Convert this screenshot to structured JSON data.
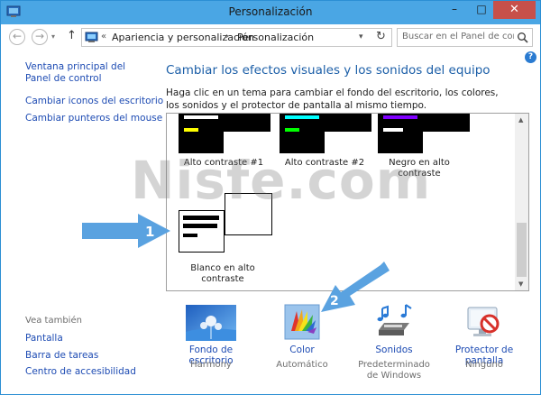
{
  "window": {
    "title": "Personalización",
    "minimize_glyph": "–",
    "maximize_glyph": "□",
    "close_glyph": "✕"
  },
  "nav": {
    "back_glyph": "←",
    "forward_glyph": "→",
    "history_glyph": "▾",
    "up_glyph": "↑",
    "breadcrumb_sep": "«",
    "breadcrumb_sep2": "›",
    "breadcrumb": [
      "Apariencia y personalización",
      "Personalización"
    ],
    "address_dropdown_glyph": "▾",
    "refresh_glyph": "↻",
    "search_placeholder": "Buscar en el Panel de con..."
  },
  "help_glyph": "?",
  "sidebar": {
    "links": [
      "Ventana principal del Panel de control",
      "Cambiar iconos del escritorio",
      "Cambiar punteros del mouse"
    ],
    "see_also_title": "Vea también",
    "see_also": [
      "Pantalla",
      "Barra de tareas",
      "Centro de accesibilidad"
    ]
  },
  "main": {
    "title": "Cambiar los efectos visuales y los sonidos del equipo",
    "description": "Haga clic en un tema para cambiar el fondo del escritorio, los colores, los sonidos y el protector de pantalla al mismo tiempo."
  },
  "themes": [
    {
      "label": "Alto contraste #1",
      "bar1": "#ffffff",
      "bar2": "#ffff00"
    },
    {
      "label": "Alto contraste #2",
      "bar1": "#00ffff",
      "bar2": "#00ff00"
    },
    {
      "label": "Negro en alto contraste",
      "bar1": "#8000ff",
      "bar2": "#ffffff"
    },
    {
      "label": "Blanco en alto contraste"
    }
  ],
  "watermark": "Nisfe.com",
  "annotations": [
    "1",
    "2"
  ],
  "bottom": [
    {
      "label": "Fondo de escritorio",
      "sub": "Harmony"
    },
    {
      "label": "Color",
      "sub": "Automático"
    },
    {
      "label": "Sonidos",
      "sub": "Predeterminado de Windows"
    },
    {
      "label": "Protector de pantalla",
      "sub": "Ninguno"
    }
  ],
  "colors": {
    "titlebar": "#4aa6e4",
    "close_button": "#c7504a",
    "link": "#1d4bb3",
    "heading": "#1c5fa8",
    "annotation_arrow": "#5aa2e0"
  }
}
